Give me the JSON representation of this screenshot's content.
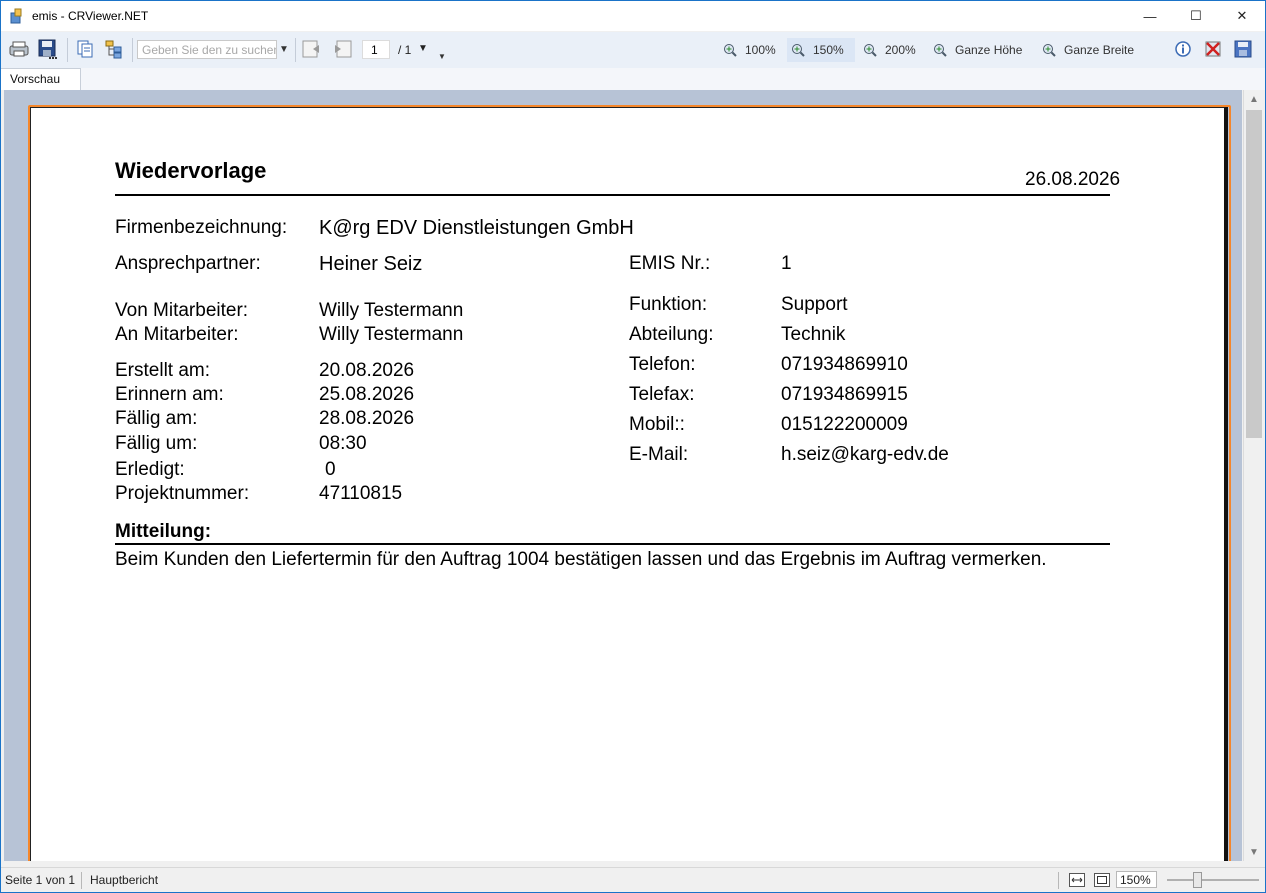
{
  "window": {
    "title": "emis - CRViewer.NET",
    "minimize_glyph": "—",
    "maximize_glyph": "☐",
    "close_glyph": "✕"
  },
  "toolbar": {
    "search_placeholder": "Geben Sie den zu suchen",
    "page_current": "1",
    "page_total": "/ 1",
    "zoom_buttons": [
      {
        "label": "100%"
      },
      {
        "label": "150%"
      },
      {
        "label": "200%"
      },
      {
        "label": "Ganze Höhe"
      },
      {
        "label": "Ganze Breite"
      }
    ]
  },
  "tabs": [
    "Vorschau"
  ],
  "report": {
    "title": "Wiedervorlage",
    "date": "26.08.2026",
    "firma_label": "Firmenbezeichnung:",
    "firma_value": "K@rg EDV Dienstleistungen GmbH",
    "left_fields": [
      {
        "label": "Ansprechpartner:",
        "value": "Heiner Seiz"
      },
      {
        "label": "Von Mitarbeiter:",
        "value": "Willy Testermann"
      },
      {
        "label": "An Mitarbeiter:",
        "value": "Willy Testermann"
      },
      {
        "label": "Erstellt am:",
        "value": "20.08.2026"
      },
      {
        "label": "Erinnern am:",
        "value": "25.08.2026"
      },
      {
        "label": "Fällig am:",
        "value": "28.08.2026"
      },
      {
        "label": "Fällig um:",
        "value": "08:30"
      },
      {
        "label": "Erledigt:",
        "value": "0"
      },
      {
        "label": "Projektnummer:",
        "value": "47110815"
      }
    ],
    "right_fields": [
      {
        "label": "EMIS Nr.:",
        "value": "1"
      },
      {
        "label": "Funktion:",
        "value": "Support"
      },
      {
        "label": "Abteilung:",
        "value": "Technik"
      },
      {
        "label": "Telefon:",
        "value": "071934869910"
      },
      {
        "label": "Telefax:",
        "value": "071934869915"
      },
      {
        "label": "Mobil::",
        "value": "015122200009"
      },
      {
        "label": "E-Mail:",
        "value": "h.seiz@karg-edv.de"
      }
    ],
    "mitteilung_label": "Mitteilung:",
    "mitteilung_text": "Beim Kunden den Liefertermin für den Auftrag 1004 bestätigen lassen und das Ergebnis im Auftrag vermerken."
  },
  "statusbar": {
    "page_info": "Seite 1 von 1",
    "report_name": "Hauptbericht",
    "zoom_value": "150%"
  },
  "icons": {
    "app": "app-icon",
    "zoom": "magnifier-plus-icon"
  },
  "colors": {
    "title_bar_border": "#1a73c8",
    "toolbar_bg": "#eaf0f8",
    "view_bg": "#b7c3d6",
    "paper_accent": "#f5862a"
  }
}
